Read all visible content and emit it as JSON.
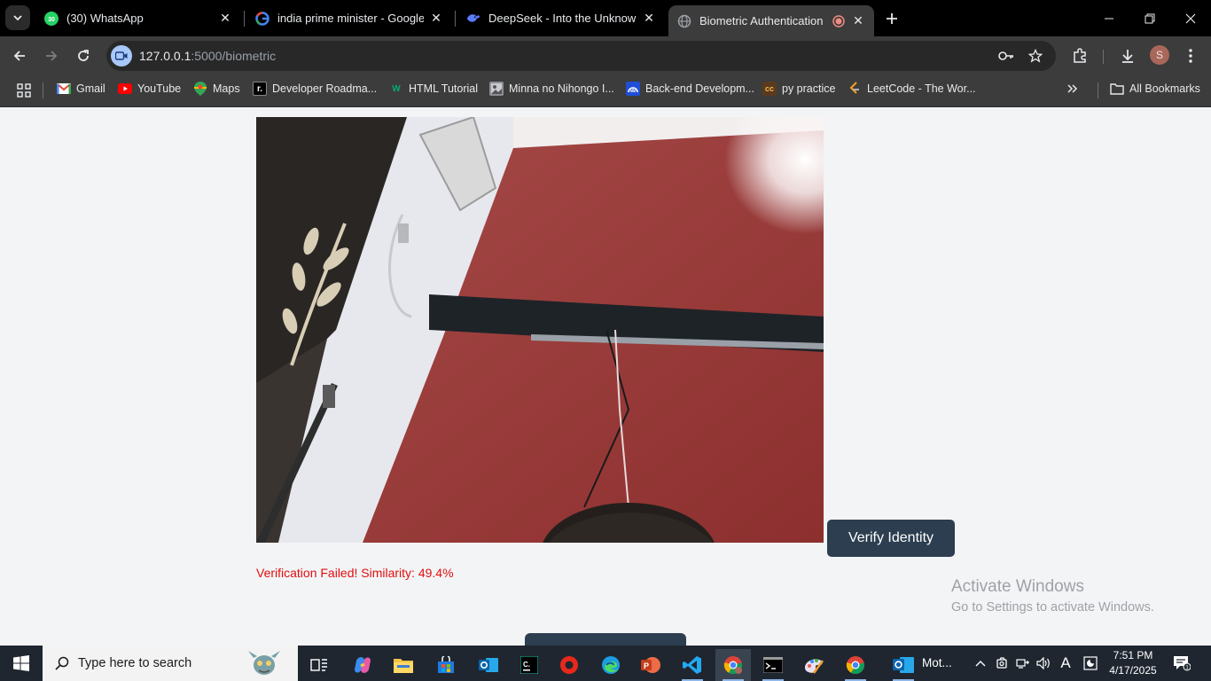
{
  "browser": {
    "tabs": [
      {
        "title": "(30) WhatsApp",
        "icon": "whatsapp-icon",
        "badge": "30",
        "active": false
      },
      {
        "title": "india prime minister - Google S",
        "icon": "google-icon",
        "active": false
      },
      {
        "title": "DeepSeek - Into the Unknown",
        "icon": "deepseek-icon",
        "active": false
      },
      {
        "title": "Biometric Authentication",
        "icon": "globe-icon",
        "active": true,
        "recording": true
      }
    ],
    "url_host": "127.0.0.1",
    "url_path": ":5000/biometric",
    "profile_initial": "S",
    "bookmarks": [
      {
        "label": "Gmail",
        "icon": "gmail-icon"
      },
      {
        "label": "YouTube",
        "icon": "youtube-icon"
      },
      {
        "label": "Maps",
        "icon": "maps-icon"
      },
      {
        "label": "Developer Roadma...",
        "icon": "roadmap-icon",
        "glyph": "r."
      },
      {
        "label": "HTML Tutorial",
        "icon": "w3schools-icon",
        "glyph": "W"
      },
      {
        "label": "Minna no Nihongo I...",
        "icon": "image-icon"
      },
      {
        "label": "Back-end Developm...",
        "icon": "coursera-icon"
      },
      {
        "label": "py practice",
        "icon": "cc-icon",
        "glyph": "cc"
      },
      {
        "label": "LeetCode - The Wor...",
        "icon": "leetcode-icon"
      }
    ],
    "all_bookmarks": "All Bookmarks"
  },
  "page": {
    "verify_button": "Verify Identity",
    "status_message": "Verification Failed! Similarity: 49.4%",
    "status_color": "#e10e0e",
    "accent_color": "#2c3e50"
  },
  "watermark": {
    "line1": "Activate Windows",
    "line2": "Go to Settings to activate Windows."
  },
  "taskbar": {
    "search_placeholder": "Type here to search",
    "mot_label": "Mot...",
    "time": "7:51 PM",
    "date": "4/17/2025",
    "notification_count": "1"
  }
}
